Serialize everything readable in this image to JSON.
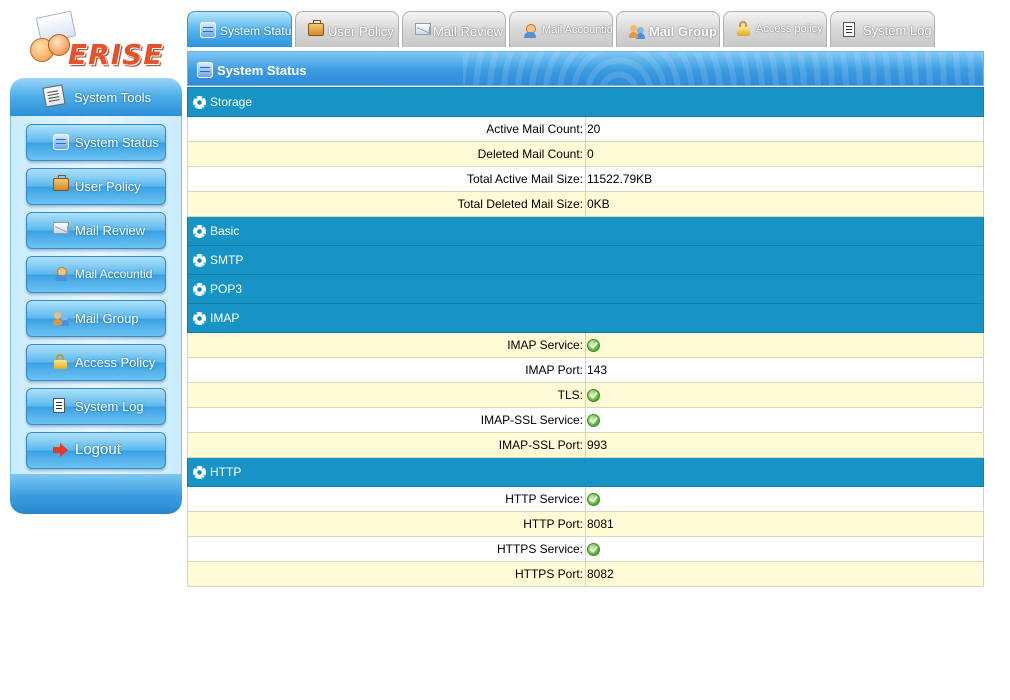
{
  "logo": {
    "text": "ERISE"
  },
  "sidebar": {
    "header": "System Tools",
    "items": [
      {
        "label": "System Status",
        "icon": "database-icon"
      },
      {
        "label": "User Policy",
        "icon": "briefcase-icon"
      },
      {
        "label": "Mail Review",
        "icon": "envelope-icon"
      },
      {
        "label": "Mail Accountid",
        "icon": "user-icon"
      },
      {
        "label": "Mail Group",
        "icon": "group-icon"
      },
      {
        "label": "Access Policy",
        "icon": "lock-icon"
      },
      {
        "label": "System Log",
        "icon": "log-icon"
      },
      {
        "label": "Logout",
        "icon": "logout-arrow-icon"
      }
    ]
  },
  "tabs": [
    {
      "label": "System Status",
      "active": true
    },
    {
      "label": "User Policy",
      "active": false
    },
    {
      "label": "Mail Review",
      "active": false
    },
    {
      "label": "Mail Accountid",
      "active": false
    },
    {
      "label": "Mail Group",
      "active": false
    },
    {
      "label": "Access policy",
      "active": false
    },
    {
      "label": "System Log",
      "active": false
    }
  ],
  "panel": {
    "title": "System Status",
    "sections": {
      "storage": {
        "title": "Storage",
        "rows": [
          {
            "key": "Active Mail Count:",
            "value": "20"
          },
          {
            "key": "Deleted Mail Count:",
            "value": "0"
          },
          {
            "key": "Total Active Mail Size:",
            "value": "11522.79KB"
          },
          {
            "key": "Total Deleted Mail Size:",
            "value": "0KB"
          }
        ]
      },
      "basic": {
        "title": "Basic"
      },
      "smtp": {
        "title": "SMTP"
      },
      "pop3": {
        "title": "POP3"
      },
      "imap": {
        "title": "IMAP",
        "rows": [
          {
            "key": "IMAP Service:",
            "status": "ok"
          },
          {
            "key": "IMAP Port:",
            "value": "143"
          },
          {
            "key": "TLS:",
            "status": "ok"
          },
          {
            "key": "IMAP-SSL Service:",
            "status": "ok"
          },
          {
            "key": "IMAP-SSL Port:",
            "value": "993"
          }
        ]
      },
      "http": {
        "title": "HTTP",
        "rows": [
          {
            "key": "HTTP Service:",
            "status": "ok"
          },
          {
            "key": "HTTP Port:",
            "value": "8081"
          },
          {
            "key": "HTTPS Service:",
            "status": "ok"
          },
          {
            "key": "HTTPS Port:",
            "value": "8082"
          }
        ]
      }
    }
  },
  "colors": {
    "section_header": "#1793c6",
    "row_alt": "#fffbd6",
    "accent_blue": "#3a9be2",
    "logo": "#e4512a"
  }
}
